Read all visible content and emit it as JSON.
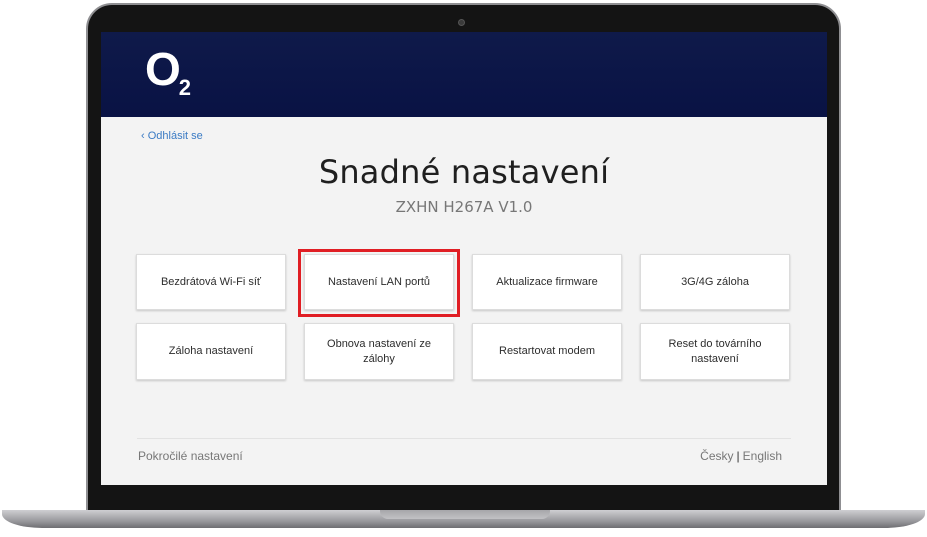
{
  "brand": {
    "logo_letter": "O",
    "logo_sub": "2",
    "header_color": "#0d1748",
    "highlight_color": "#e01e24",
    "link_color": "#3b7bc4"
  },
  "nav": {
    "logout_label": "‹ Odhlásit se"
  },
  "page": {
    "title": "Snadné nastavení",
    "subtitle": "ZXHN H267A V1.0"
  },
  "tiles": [
    {
      "label": "Bezdrátová Wi-Fi síť"
    },
    {
      "label": "Nastavení LAN portů",
      "highlighted": true
    },
    {
      "label": "Aktualizace firmware"
    },
    {
      "label": "3G/4G záloha"
    },
    {
      "label": "Záloha nastavení"
    },
    {
      "label": "Obnova nastavení ze zálohy"
    },
    {
      "label": "Restartovat modem"
    },
    {
      "label": "Reset do továrního nastavení"
    }
  ],
  "footer": {
    "advanced_label": "Pokročilé nastavení",
    "lang_cz": "Česky",
    "lang_separator": "|",
    "lang_en": "English"
  }
}
